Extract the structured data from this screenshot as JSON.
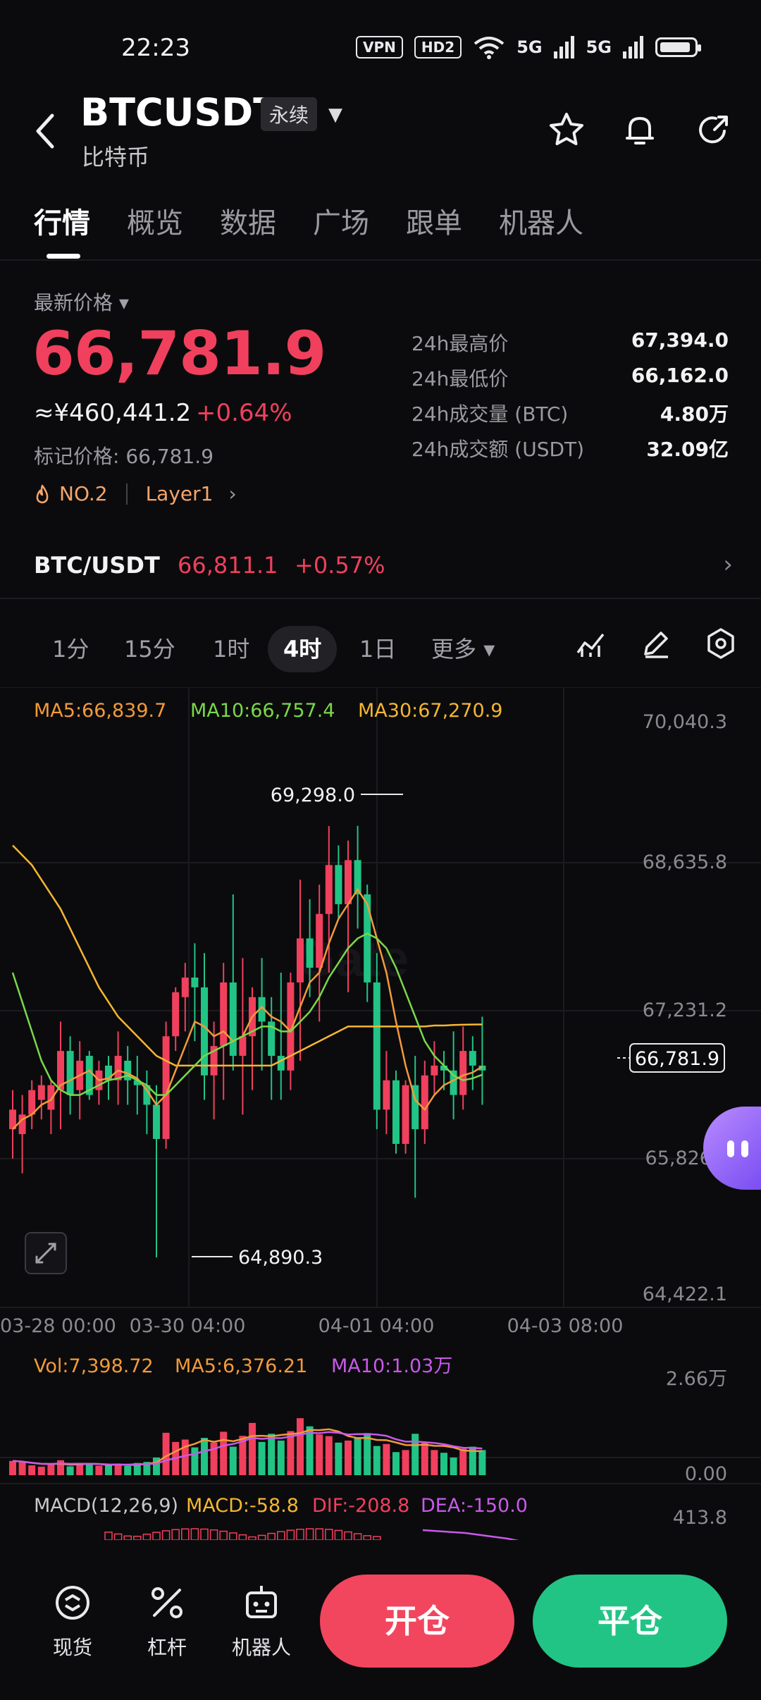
{
  "status_bar": {
    "time": "22:23",
    "vpn": "VPN",
    "hd": "HD2",
    "sig1": "5G",
    "sig2": "5G"
  },
  "header": {
    "pair": "BTCUSDT",
    "badge": "永续",
    "subname": "比特币",
    "icons": [
      "star-icon",
      "bell-icon",
      "share-icon"
    ]
  },
  "tabs": [
    "行情",
    "概览",
    "数据",
    "广场",
    "跟单",
    "机器人"
  ],
  "price": {
    "label": "最新价格",
    "last": "66,781.9",
    "cny": "≈¥460,441.2",
    "change": "+0.64%",
    "mark": "标记价格: 66,781.9",
    "rank": "NO.2",
    "category": "Layer1",
    "stats": [
      {
        "k": "24h最高价",
        "v": "67,394.0"
      },
      {
        "k": "24h最低价",
        "v": "66,162.0"
      },
      {
        "k": "24h成交量 (BTC)",
        "v": "4.80万"
      },
      {
        "k": "24h成交额 (USDT)",
        "v": "32.09亿"
      }
    ]
  },
  "spot": {
    "pair": "BTC/USDT",
    "price": "66,811.1",
    "change": "+0.57%"
  },
  "intervals": [
    "1分",
    "15分",
    "1时",
    "4时",
    "1日",
    "更多"
  ],
  "active_interval": "4时",
  "chart": {
    "ma5": "MA5:66,839.7",
    "ma10": "MA10:66,757.4",
    "ma30": "MA30:67,270.9",
    "y_ticks": [
      "70,040.3",
      "68,635.8",
      "67,231.2",
      "65,826",
      "64,422.1"
    ],
    "x_ticks": [
      "03-28 00:00",
      "03-30 04:00",
      "04-01 04:00",
      "04-03 08:00"
    ],
    "high_label": "69,298.0",
    "low_label": "64,890.3",
    "last_label": "66,781.9",
    "vol": "Vol:7,398.72",
    "vol_ma5": "MA5:6,376.21",
    "vol_ma10": "MA10:1.03万",
    "vol_ticks": [
      "2.66万",
      "0.00"
    ],
    "macd_title": "MACD(12,26,9)",
    "macd": "MACD:-58.8",
    "dif": "DIF:-208.8",
    "dea": "DEA:-150.0",
    "macd_tick": "413.8"
  },
  "bottom": {
    "spot": "现货",
    "leverage": "杠杆",
    "bot": "机器人",
    "open": "开仓",
    "close": "平仓"
  },
  "colors": {
    "up": "#f0405d",
    "down": "#22c485",
    "ma5": "#f29a3a",
    "ma10": "#7ad84a",
    "ma30": "#f5b632"
  },
  "chart_data": {
    "type": "candlestick",
    "ylim": [
      64422.1,
      70040.3
    ],
    "candles": [
      {
        "o": 66200,
        "h": 66600,
        "l": 65900,
        "c": 66400
      },
      {
        "o": 66150,
        "h": 66550,
        "l": 65750,
        "c": 66350
      },
      {
        "o": 66350,
        "h": 66700,
        "l": 66200,
        "c": 66600
      },
      {
        "o": 66500,
        "h": 66750,
        "l": 66300,
        "c": 66650
      },
      {
        "o": 66400,
        "h": 66700,
        "l": 66150,
        "c": 66650
      },
      {
        "o": 66600,
        "h": 67300,
        "l": 66200,
        "c": 67000
      },
      {
        "o": 67000,
        "h": 67150,
        "l": 66350,
        "c": 66550
      },
      {
        "o": 66600,
        "h": 67100,
        "l": 66300,
        "c": 66900
      },
      {
        "o": 66950,
        "h": 67000,
        "l": 66500,
        "c": 66550
      },
      {
        "o": 66600,
        "h": 66900,
        "l": 66450,
        "c": 66800
      },
      {
        "o": 66850,
        "h": 66950,
        "l": 66500,
        "c": 66700
      },
      {
        "o": 66700,
        "h": 67200,
        "l": 66450,
        "c": 66950
      },
      {
        "o": 66900,
        "h": 67050,
        "l": 66450,
        "c": 66700
      },
      {
        "o": 66700,
        "h": 66950,
        "l": 66350,
        "c": 66650
      },
      {
        "o": 66650,
        "h": 66800,
        "l": 66150,
        "c": 66450
      },
      {
        "o": 66450,
        "h": 66650,
        "l": 64890,
        "c": 66100
      },
      {
        "o": 66100,
        "h": 67300,
        "l": 66000,
        "c": 67150
      },
      {
        "o": 67150,
        "h": 67650,
        "l": 67000,
        "c": 67600
      },
      {
        "o": 67550,
        "h": 67900,
        "l": 67200,
        "c": 67750
      },
      {
        "o": 67750,
        "h": 68100,
        "l": 67100,
        "c": 67650
      },
      {
        "o": 67650,
        "h": 68000,
        "l": 66500,
        "c": 66750
      },
      {
        "o": 66750,
        "h": 67300,
        "l": 66300,
        "c": 67050
      },
      {
        "o": 67050,
        "h": 67900,
        "l": 66500,
        "c": 67700
      },
      {
        "o": 67700,
        "h": 68600,
        "l": 66800,
        "c": 66950
      },
      {
        "o": 66950,
        "h": 67950,
        "l": 66350,
        "c": 67150
      },
      {
        "o": 67150,
        "h": 67650,
        "l": 66600,
        "c": 67550
      },
      {
        "o": 67550,
        "h": 67950,
        "l": 66800,
        "c": 67300
      },
      {
        "o": 67300,
        "h": 67550,
        "l": 66500,
        "c": 66950
      },
      {
        "o": 66950,
        "h": 67800,
        "l": 66500,
        "c": 66800
      },
      {
        "o": 66800,
        "h": 67800,
        "l": 66600,
        "c": 67700
      },
      {
        "o": 67700,
        "h": 68750,
        "l": 66900,
        "c": 68150
      },
      {
        "o": 68150,
        "h": 68550,
        "l": 67550,
        "c": 67850
      },
      {
        "o": 67850,
        "h": 68700,
        "l": 67300,
        "c": 68400
      },
      {
        "o": 68400,
        "h": 69298,
        "l": 67800,
        "c": 68900
      },
      {
        "o": 68900,
        "h": 69100,
        "l": 68350,
        "c": 68500
      },
      {
        "o": 68500,
        "h": 69150,
        "l": 67600,
        "c": 68950
      },
      {
        "o": 68950,
        "h": 69300,
        "l": 68250,
        "c": 68600
      },
      {
        "o": 68600,
        "h": 68700,
        "l": 67500,
        "c": 67700
      },
      {
        "o": 67700,
        "h": 68000,
        "l": 66200,
        "c": 66400
      },
      {
        "o": 66400,
        "h": 67000,
        "l": 66150,
        "c": 66700
      },
      {
        "o": 66700,
        "h": 66800,
        "l": 65950,
        "c": 66050
      },
      {
        "o": 66050,
        "h": 66700,
        "l": 65950,
        "c": 66650
      },
      {
        "o": 66650,
        "h": 66950,
        "l": 65500,
        "c": 66200
      },
      {
        "o": 66200,
        "h": 66900,
        "l": 66050,
        "c": 66750
      },
      {
        "o": 66750,
        "h": 67100,
        "l": 66550,
        "c": 66850
      },
      {
        "o": 66850,
        "h": 67000,
        "l": 66600,
        "c": 66800
      },
      {
        "o": 66800,
        "h": 67200,
        "l": 66300,
        "c": 66550
      },
      {
        "o": 66550,
        "h": 67250,
        "l": 66400,
        "c": 67000
      },
      {
        "o": 67000,
        "h": 67150,
        "l": 66600,
        "c": 66850
      },
      {
        "o": 66850,
        "h": 67350,
        "l": 66450,
        "c": 66800
      }
    ],
    "ma5": [
      66200,
      66300,
      66350,
      66450,
      66500,
      66650,
      66700,
      66750,
      66800,
      66700,
      66720,
      66800,
      66770,
      66720,
      66600,
      66450,
      66550,
      66800,
      67050,
      67300,
      67250,
      67150,
      67200,
      67100,
      67150,
      67350,
      67450,
      67350,
      67300,
      67200,
      67450,
      67700,
      67800,
      68100,
      68350,
      68500,
      68650,
      68500,
      68150,
      67800,
      67300,
      66850,
      66500,
      66400,
      66550,
      66650,
      66700,
      66750,
      66780,
      66840
    ],
    "ma10": [
      67800,
      67500,
      67200,
      66900,
      66700,
      66600,
      66550,
      66550,
      66600,
      66650,
      66700,
      66720,
      66750,
      66700,
      66650,
      66550,
      66550,
      66650,
      66750,
      66850,
      66950,
      67000,
      67050,
      67100,
      67150,
      67200,
      67250,
      67250,
      67200,
      67200,
      67300,
      67400,
      67550,
      67750,
      67900,
      68050,
      68150,
      68200,
      68150,
      68050,
      67850,
      67600,
      67350,
      67100,
      66950,
      66850,
      66750,
      66700,
      66720,
      66757
    ],
    "ma30": [
      69100,
      69000,
      68900,
      68750,
      68600,
      68450,
      68250,
      68050,
      67850,
      67650,
      67500,
      67350,
      67250,
      67150,
      67050,
      66950,
      66900,
      66850,
      66850,
      66850,
      66850,
      66850,
      66850,
      66850,
      66850,
      66850,
      66850,
      66850,
      66900,
      66950,
      67000,
      67050,
      67100,
      67150,
      67200,
      67250,
      67250,
      67250,
      67250,
      67250,
      67250,
      67250,
      67250,
      67250,
      67260,
      67260,
      67265,
      67268,
      67270,
      67271
    ],
    "volume": [
      4200,
      3800,
      2900,
      2500,
      3100,
      4400,
      2600,
      3500,
      3200,
      2800,
      3000,
      3300,
      2700,
      3600,
      3900,
      5200,
      12500,
      9800,
      10500,
      8200,
      11000,
      9600,
      12800,
      8400,
      11600,
      15400,
      9800,
      12200,
      10200,
      13000,
      16800,
      14400,
      12000,
      11500,
      9600,
      10200,
      11200,
      12400,
      8600,
      9200,
      6800,
      7400,
      12200,
      9500,
      7400,
      6600,
      5200,
      7800,
      8400,
      7400
    ]
  }
}
